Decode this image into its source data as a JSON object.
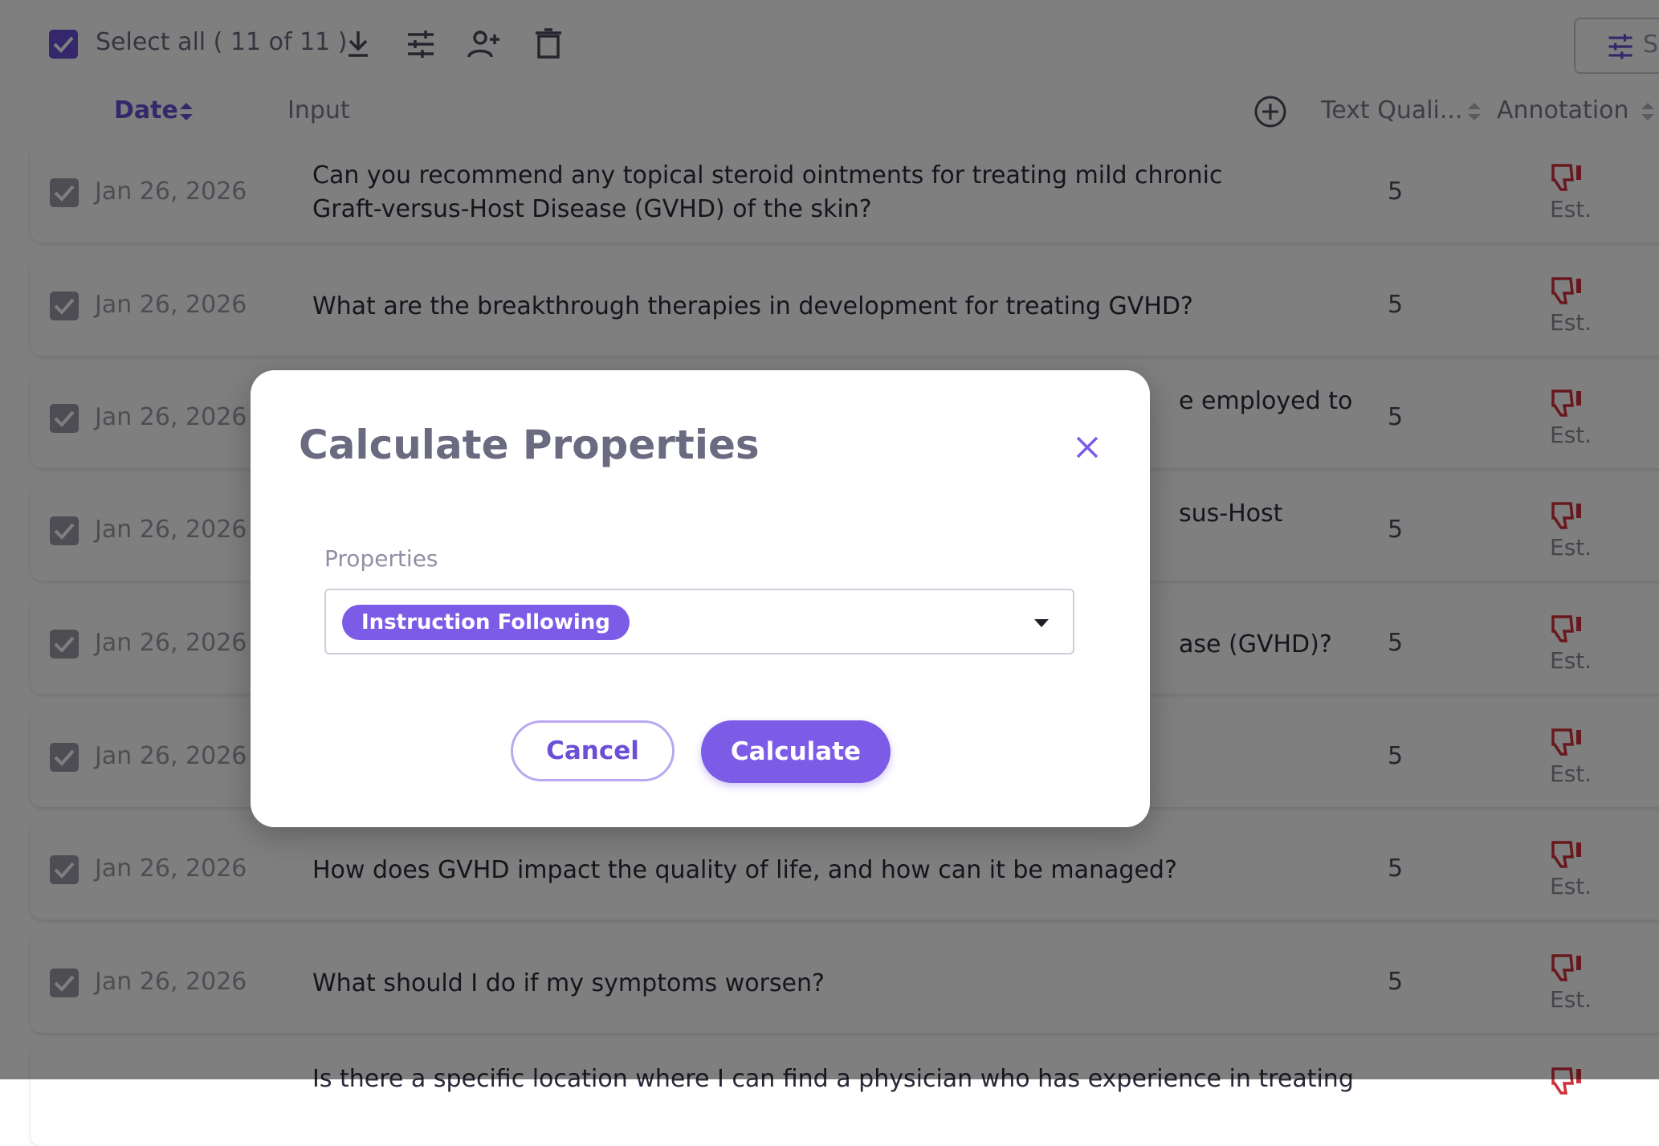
{
  "toolbar": {
    "select_all_label": "Select all ( 11 of 11 )",
    "icons": [
      "download-icon",
      "sliders-icon",
      "add-user-icon",
      "trash-icon"
    ],
    "filter_box_text": "S"
  },
  "table": {
    "headers": {
      "date": "Date",
      "input": "Input",
      "text_quality": "Text Quali...",
      "annotation": "Annotation"
    },
    "rows": [
      {
        "date": "Jan 26, 2026",
        "input": "Can you recommend any topical steroid ointments for treating mild chronic Graft-versus-Host Disease (GVHD) of the skin?",
        "tq": "5",
        "ann": "Est."
      },
      {
        "date": "Jan 26, 2026",
        "input": "What are the breakthrough therapies in development for treating GVHD?",
        "tq": "5",
        "ann": "Est."
      },
      {
        "date": "Jan 26, 2026",
        "input": "e employed to",
        "tq": "5",
        "ann": "Est."
      },
      {
        "date": "Jan 26, 2026",
        "input": "sus-Host",
        "tq": "5",
        "ann": "Est."
      },
      {
        "date": "Jan 26, 2026",
        "input": "ase (GVHD)?",
        "tq": "5",
        "ann": "Est."
      },
      {
        "date": "Jan 26, 2026",
        "input": "",
        "tq": "5",
        "ann": "Est."
      },
      {
        "date": "Jan 26, 2026",
        "input": "How does GVHD impact the quality of life, and how can it be managed?",
        "tq": "5",
        "ann": "Est."
      },
      {
        "date": "Jan 26, 2026",
        "input": "What should I do if my symptoms worsen?",
        "tq": "5",
        "ann": "Est."
      },
      {
        "date": "",
        "input": "Is there a specific location where I can find a physician who has experience in treating",
        "tq": "",
        "ann": ""
      }
    ]
  },
  "modal": {
    "title": "Calculate Properties",
    "field_label": "Properties",
    "selected_chip": "Instruction Following",
    "cancel_label": "Cancel",
    "calculate_label": "Calculate"
  },
  "colors": {
    "accent": "#7c5ce6",
    "thumbs_down": "#d0303a"
  }
}
